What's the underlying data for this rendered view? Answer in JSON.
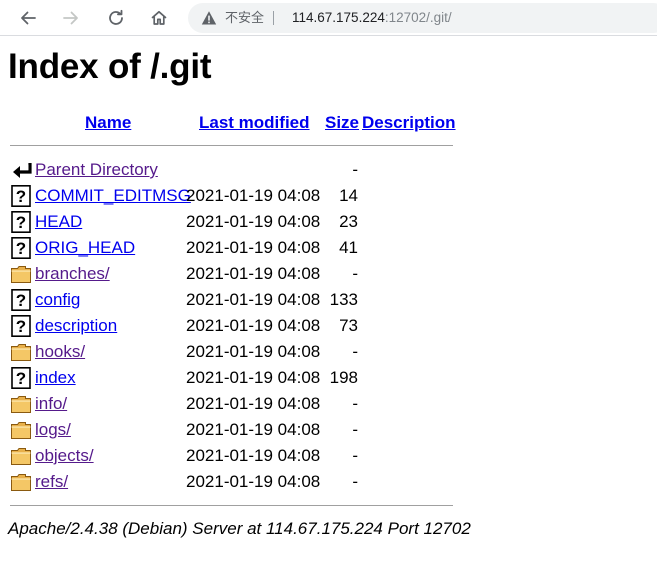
{
  "browser": {
    "security_label": "不安全",
    "url_host": "114.67.175.224",
    "url_path": ":12702/.git/"
  },
  "page": {
    "title": "Index of /.git",
    "columns": {
      "name": "Name",
      "last_modified": "Last modified",
      "size": "Size",
      "description": "Description"
    },
    "entries": [
      {
        "name": "Parent Directory",
        "date": "",
        "size": "-",
        "icon": "back-icon",
        "visited": true
      },
      {
        "name": "COMMIT_EDITMSG",
        "date": "2021-01-19 04:08",
        "size": "14",
        "icon": "unknown-file-icon",
        "visited": false
      },
      {
        "name": "HEAD",
        "date": "2021-01-19 04:08",
        "size": "23",
        "icon": "unknown-file-icon",
        "visited": false
      },
      {
        "name": "ORIG_HEAD",
        "date": "2021-01-19 04:08",
        "size": "41",
        "icon": "unknown-file-icon",
        "visited": false
      },
      {
        "name": "branches/",
        "date": "2021-01-19 04:08",
        "size": "-",
        "icon": "folder-icon",
        "visited": true
      },
      {
        "name": "config",
        "date": "2021-01-19 04:08",
        "size": "133",
        "icon": "unknown-file-icon",
        "visited": false
      },
      {
        "name": "description",
        "date": "2021-01-19 04:08",
        "size": "73",
        "icon": "unknown-file-icon",
        "visited": false
      },
      {
        "name": "hooks/",
        "date": "2021-01-19 04:08",
        "size": "-",
        "icon": "folder-icon",
        "visited": true
      },
      {
        "name": "index",
        "date": "2021-01-19 04:08",
        "size": "198",
        "icon": "unknown-file-icon",
        "visited": false
      },
      {
        "name": "info/",
        "date": "2021-01-19 04:08",
        "size": "-",
        "icon": "folder-icon",
        "visited": true
      },
      {
        "name": "logs/",
        "date": "2021-01-19 04:08",
        "size": "-",
        "icon": "folder-icon",
        "visited": true
      },
      {
        "name": "objects/",
        "date": "2021-01-19 04:08",
        "size": "-",
        "icon": "folder-icon",
        "visited": true
      },
      {
        "name": "refs/",
        "date": "2021-01-19 04:08",
        "size": "-",
        "icon": "folder-icon",
        "visited": true
      }
    ],
    "footer": "Apache/2.4.38 (Debian) Server at 114.67.175.224 Port 12702"
  },
  "colors": {
    "link": "#0000ee",
    "visited_link": "#551a8b",
    "folder": "#e8b04a"
  }
}
